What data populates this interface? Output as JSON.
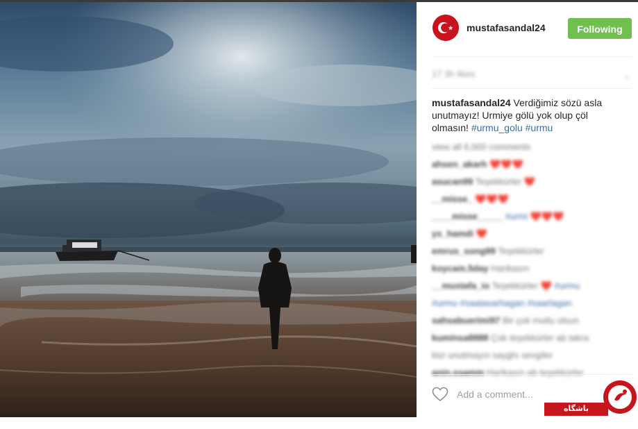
{
  "post": {
    "username": "mustafasandal24",
    "follow_label": "Following",
    "time_ago": "17 3h likes",
    "caption_user": "mustafasandal24",
    "caption_text": "Verdiğimiz sözü asla unutmayız! Urmiye gölü yok olup çöl olmasın!",
    "hashtags": [
      "#urmu_golu",
      "#urmu"
    ],
    "view_all": "view all 6,000 comments",
    "comments": [
      {
        "user": "ahsen_akarh",
        "text": "❤️❤️❤️"
      },
      {
        "user": "asucan99",
        "text": "Teşekkürler ❤️",
        "tags": ""
      },
      {
        "user": "__misse_",
        "text": "❤️❤️❤️"
      },
      {
        "user": "____misse_____",
        "text": "",
        "tags": "#urmi ❤️❤️❤️"
      },
      {
        "user": "ys_hamdi",
        "text": "❤️"
      },
      {
        "user": "emrus_song99",
        "text": "Teşekkürler"
      },
      {
        "user": "koycam.5day",
        "text": "Harikasın"
      },
      {
        "user": "__mustafa_io",
        "text": "Teşekkürler ❤️",
        "tags": "#urmu"
      },
      {
        "user": "",
        "text": "",
        "tags": "#urmu #saatasarhagan #saarlagan"
      },
      {
        "user": "sahsabuerimi97",
        "text": "Bir çok mutlu olsun"
      },
      {
        "user": "kuminsa8888",
        "text": "Çok teşekkürler ab takra"
      },
      {
        "user": "",
        "text": "bizi unutmayın sayghı sevgiler"
      },
      {
        "user": "anin.ssamm",
        "text": "Harikasın ab teşekkürler"
      }
    ],
    "add_comment_placeholder": "Add a comment..."
  },
  "watermark": {
    "label": "باشگاه خبرنگاران"
  },
  "colors": {
    "follow_green": "#70c050",
    "hashtag_blue": "#3b6ea5",
    "avatar_red": "#c9141d",
    "watermark_red": "#c4161c"
  },
  "icons": {
    "avatar": "turkish-flag-crescent-star",
    "like": "heart-outline-icon",
    "more": "chevron-down-icon"
  }
}
